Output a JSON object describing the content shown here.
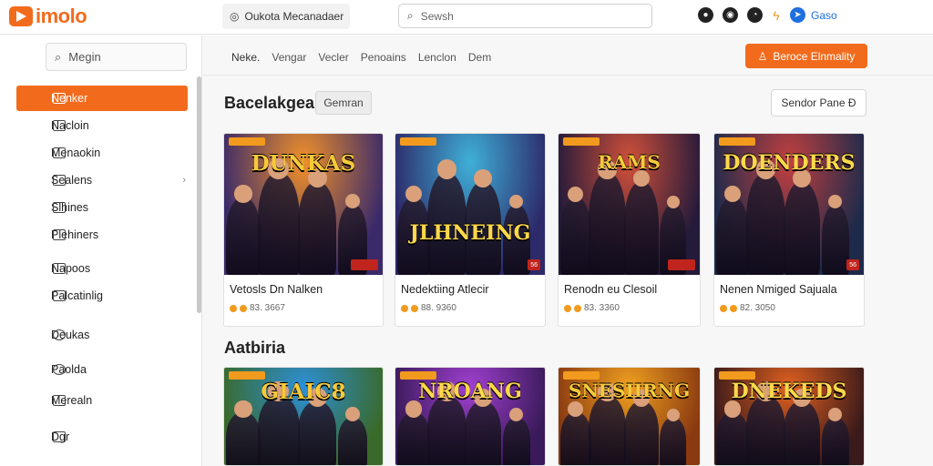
{
  "app": {
    "logo_text": "imolo",
    "location": "Oukota Mecanadaer",
    "search_placeholder": "Sewsh"
  },
  "top_icons": [
    "camera-icon",
    "record-icon",
    "rss-icon",
    "lightning-icon",
    "messenger-icon"
  ],
  "user": {
    "label": "Gaso"
  },
  "sidebar": {
    "search_placeholder": "Megin",
    "items": [
      {
        "label": "Nenker",
        "icon": "calendar-icon",
        "active": true
      },
      {
        "label": "Nacloin",
        "icon": "list-icon"
      },
      {
        "label": "Menaokin",
        "icon": "chat-icon"
      },
      {
        "label": "Sealens",
        "icon": "folder-icon",
        "has_arrow": true
      },
      {
        "label": "Slhines",
        "icon": "image-icon"
      },
      {
        "label": "Plehiners",
        "icon": "grid-icon"
      },
      {
        "label": "Napoos",
        "icon": "file-icon"
      },
      {
        "label": "Palcatinlig",
        "icon": "square-icon"
      },
      {
        "label": "Deukas",
        "icon": "circle-icon"
      },
      {
        "label": "Paolda",
        "icon": "disc-icon"
      },
      {
        "label": "Merealn",
        "icon": "barcode-icon"
      },
      {
        "label": "Dgr",
        "icon": "inbox-icon"
      }
    ]
  },
  "nav": {
    "items": [
      "Neke.",
      "Vengar",
      "Vecler",
      "Penoains",
      "Lenclon",
      "Dem"
    ]
  },
  "cta": {
    "label": "Beroce Elnmality"
  },
  "section1": {
    "title": "Bacelakgea",
    "chip": "Gemran",
    "sort_label": "Sendor Pane Ð"
  },
  "section2": {
    "title": "Aatbiria"
  },
  "cards_row1": [
    {
      "title": "Vetosls Dn Nalken",
      "meta": "83. 3667",
      "art_title": "DUNKAS",
      "colors": [
        "#f0902a",
        "#3a2a6a"
      ],
      "badge": ""
    },
    {
      "title": "Nedektiing Atlecir",
      "meta": "88. 9360",
      "art_title": "JLHNEING",
      "colors": [
        "#3fb0d8",
        "#2c2a6a"
      ],
      "badge": "56"
    },
    {
      "title": "Renodn eu Clesoil",
      "meta": "83. 3360",
      "art_title": "RAMS",
      "colors": [
        "#d0503a",
        "#241a3a"
      ],
      "badge": ""
    },
    {
      "title": "Nenen Nmiged Sajuala",
      "meta": "82. 3050",
      "art_title": "DOENDERS",
      "colors": [
        "#c04040",
        "#1e2a4a"
      ],
      "badge": "56"
    }
  ],
  "cards_row2": [
    {
      "art_title": "GIAIC8",
      "colors": [
        "#2c8fd8",
        "#3a6a2a"
      ]
    },
    {
      "art_title": "NROANG",
      "colors": [
        "#a040d0",
        "#3a1a5a"
      ]
    },
    {
      "art_title": "SNESIIRNG",
      "colors": [
        "#f0a020",
        "#8a3a10"
      ]
    },
    {
      "art_title": "DNEKEDS",
      "colors": [
        "#e06020",
        "#3a1a1a"
      ]
    }
  ]
}
